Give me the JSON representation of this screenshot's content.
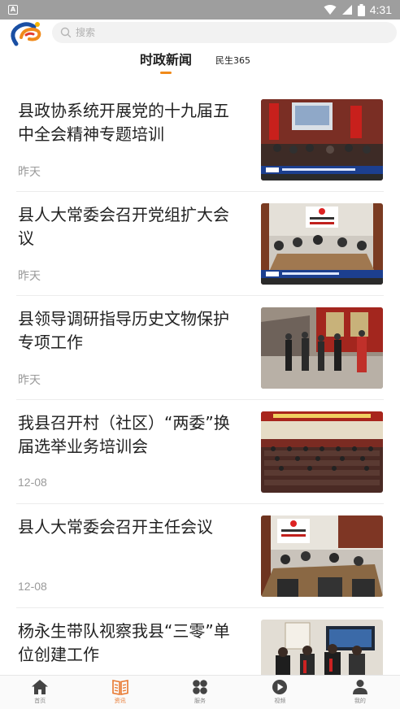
{
  "status_bar": {
    "left_badge": "A",
    "time": "4:31"
  },
  "header": {
    "search_placeholder": "搜索",
    "tabs": [
      {
        "label": "时政新闻",
        "active": true
      },
      {
        "label": "民生365",
        "active": false
      }
    ]
  },
  "news": [
    {
      "title": "县政协系统开展党的十九届五中全会精神专题培训",
      "date": "昨天",
      "thumb": "meeting-banner"
    },
    {
      "title": "县人大常委会召开党组扩大会议",
      "date": "昨天",
      "thumb": "conference-table"
    },
    {
      "title": "县领导调研指导历史文物保护专项工作",
      "date": "昨天",
      "thumb": "outdoor-visit"
    },
    {
      "title": "我县召开村（社区）“两委”换届选举业务培训会",
      "date": "12-08",
      "thumb": "auditorium"
    },
    {
      "title": "县人大常委会召开主任会议",
      "date": "12-08",
      "thumb": "conference-table"
    },
    {
      "title": "杨永生带队视察我县“三零”单位创建工作",
      "date": "",
      "thumb": "indoor-visit"
    }
  ],
  "bottom_nav": [
    {
      "label": "首页",
      "icon": "home-icon",
      "active": false
    },
    {
      "label": "资讯",
      "icon": "news-icon",
      "active": true
    },
    {
      "label": "服务",
      "icon": "grid-icon",
      "active": false
    },
    {
      "label": "视频",
      "icon": "play-icon",
      "active": false
    },
    {
      "label": "我的",
      "icon": "user-icon",
      "active": false
    }
  ],
  "colors": {
    "accent": "#e8772e",
    "status_bar": "#9e9e9e",
    "logo_blue": "#1a4fa3",
    "logo_orange": "#f08a1a"
  }
}
